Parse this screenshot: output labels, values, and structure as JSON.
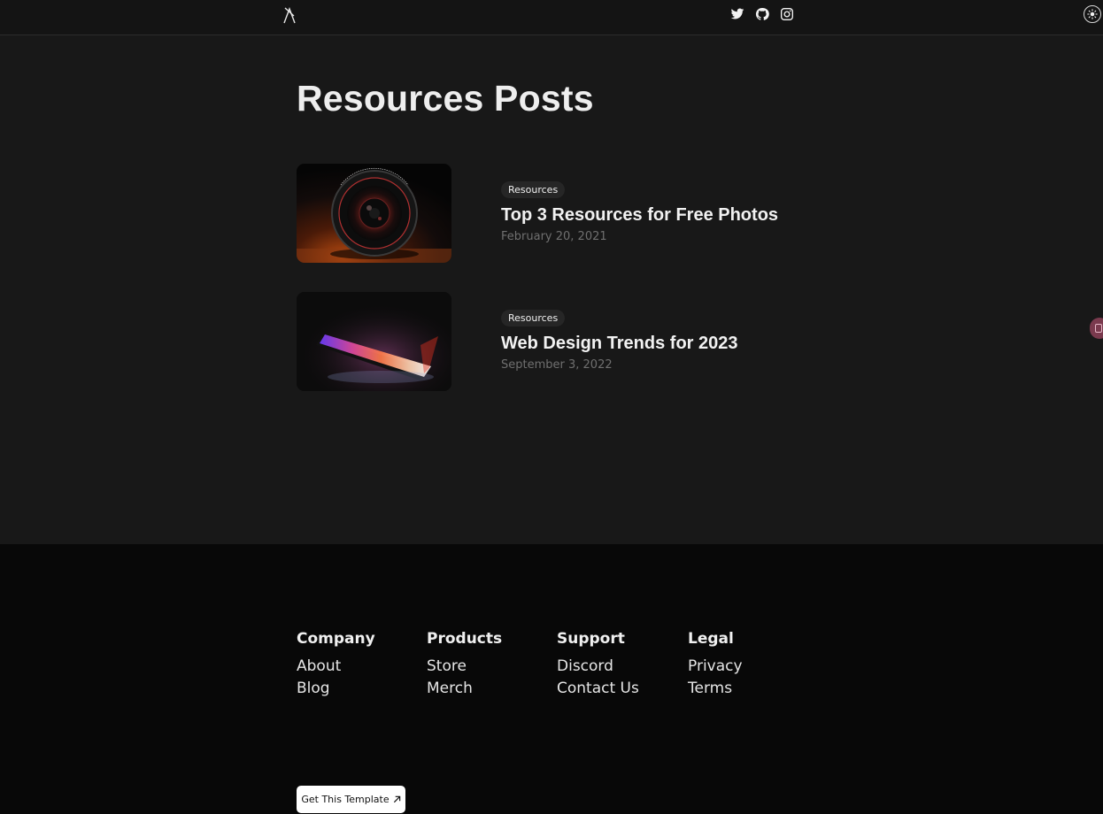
{
  "nav": {
    "logo_icon": "logo-mark-icon",
    "social": [
      {
        "name": "twitter-icon"
      },
      {
        "name": "github-icon"
      },
      {
        "name": "instagram-icon"
      }
    ],
    "theme_toggle_icon": "sun-icon"
  },
  "main": {
    "title": "Resources Posts",
    "posts": [
      {
        "tag": "Resources",
        "title": "Top 3 Resources for Free Photos",
        "date": "February 20, 2021",
        "image": "camera-lens-photo"
      },
      {
        "tag": "Resources",
        "title": "Web Design Trends for 2023",
        "date": "September 3, 2022",
        "image": "glowing-phone-photo"
      }
    ]
  },
  "footer": {
    "columns": [
      {
        "heading": "Company",
        "links": [
          "About",
          "Blog"
        ]
      },
      {
        "heading": "Products",
        "links": [
          "Store",
          "Merch"
        ]
      },
      {
        "heading": "Support",
        "links": [
          "Discord",
          "Contact Us"
        ]
      },
      {
        "heading": "Legal",
        "links": [
          "Privacy",
          "Terms"
        ]
      }
    ],
    "cta_label": "Get This Template",
    "cta_icon": "arrow-up-right-icon"
  },
  "colors": {
    "background": "#181818",
    "footer_background": "#080808",
    "tag_background": "#262626",
    "side_handle": "#7a3a4e"
  }
}
